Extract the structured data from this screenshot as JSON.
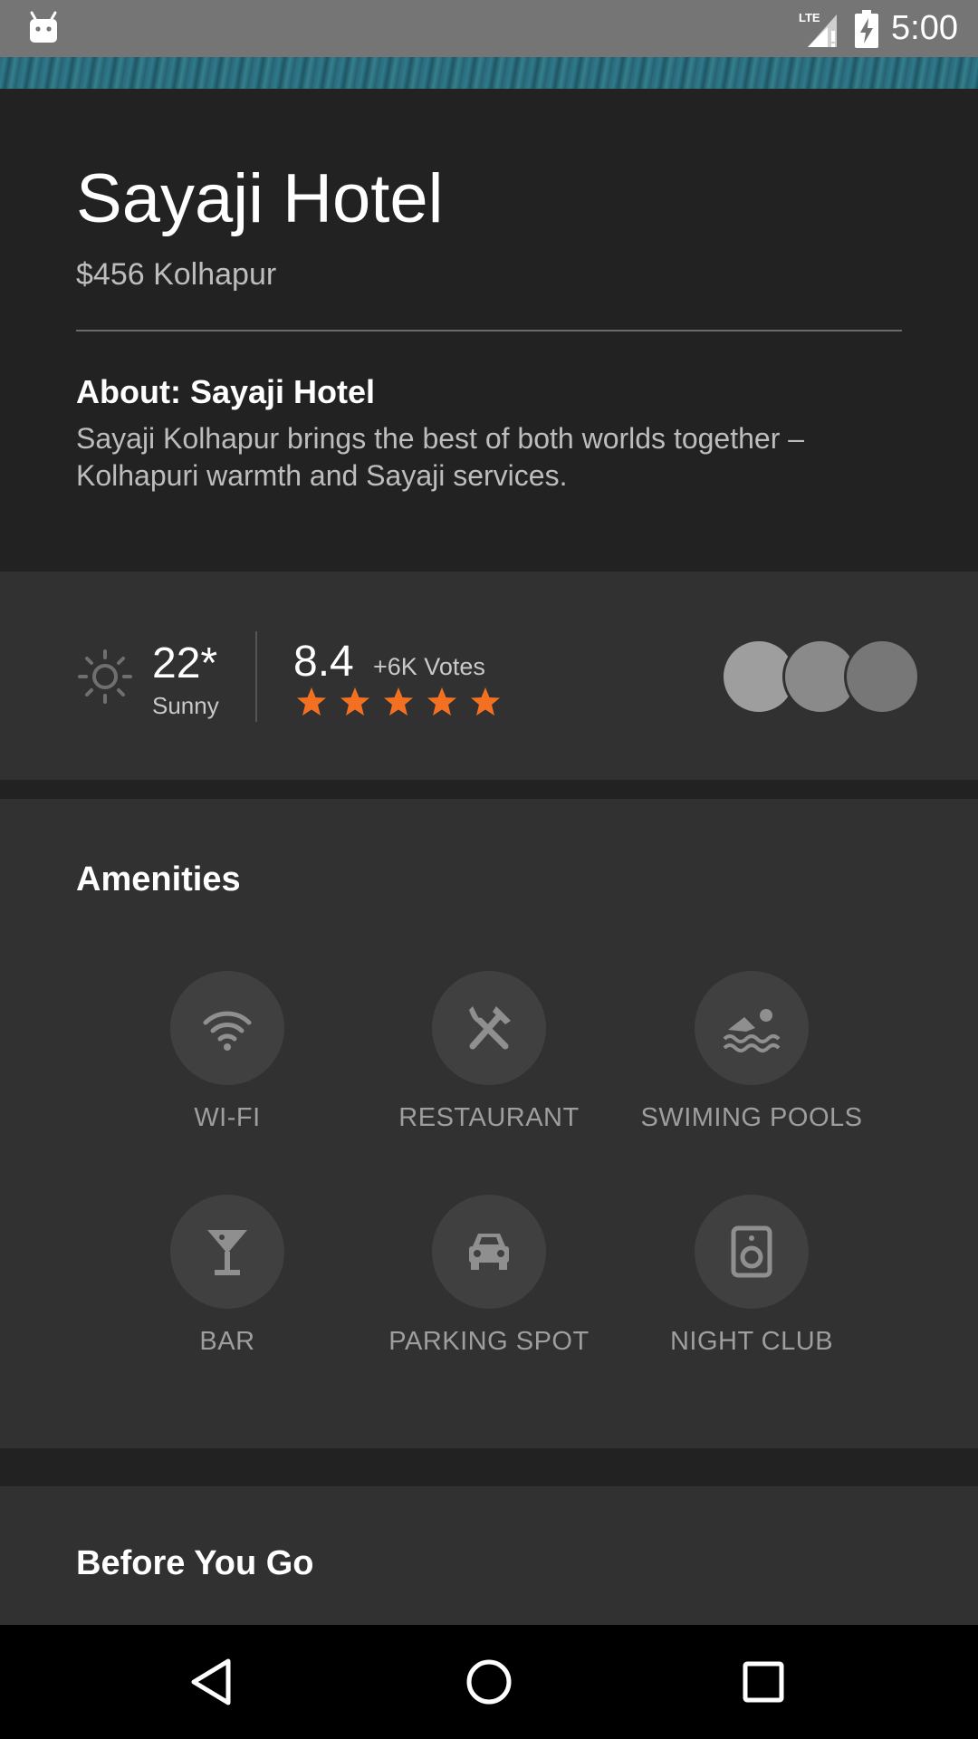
{
  "status_bar": {
    "time": "5:00",
    "network": "LTE",
    "icons": [
      "android-icon",
      "signal-icon",
      "battery-charging-icon"
    ]
  },
  "hotel": {
    "name": "Sayaji Hotel",
    "subtitle": "$456 Kolhapur",
    "about_title": "About: Sayaji Hotel",
    "about_text": "Sayaji Kolhapur brings the best of both worlds together – Kolhapuri warmth and Sayaji services."
  },
  "info": {
    "temperature": "22*",
    "weather": "Sunny",
    "rating": "8.4",
    "votes": "+6K Votes",
    "stars": 5,
    "star_color": "#f36f21",
    "avatars": [
      "#9e9e9e",
      "#8a8a8a",
      "#777777"
    ]
  },
  "amenities": {
    "title": "Amenities",
    "items": [
      {
        "label": "WI-FI",
        "icon": "wifi-icon"
      },
      {
        "label": "RESTAURANT",
        "icon": "restaurant-icon"
      },
      {
        "label": "SWIMING POOLS",
        "icon": "swimming-icon"
      },
      {
        "label": "BAR",
        "icon": "cocktail-icon"
      },
      {
        "label": "PARKING SPOT",
        "icon": "car-icon"
      },
      {
        "label": "NIGHT CLUB",
        "icon": "speaker-icon"
      }
    ]
  },
  "before_you_go": {
    "title": "Before You Go"
  },
  "nav": {
    "buttons": [
      "back-icon",
      "home-icon",
      "recents-icon"
    ]
  }
}
